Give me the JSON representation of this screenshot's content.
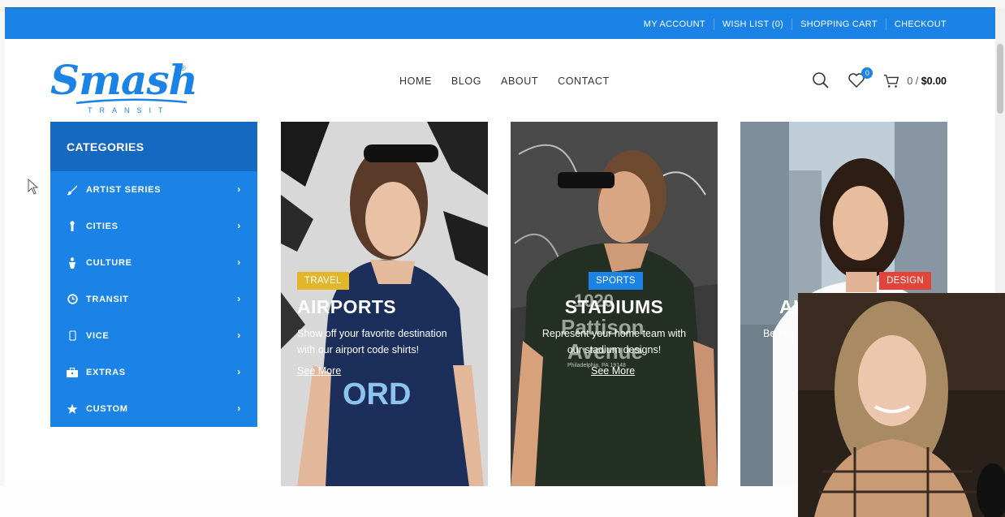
{
  "topbar": {
    "links": [
      "MY ACCOUNT",
      "WISH LIST (0)",
      "SHOPPING CART",
      "CHECKOUT"
    ]
  },
  "logo": {
    "word": "Smash",
    "sub": "TRANSIT",
    "reg": "®"
  },
  "nav": [
    "HOME",
    "BLOG",
    "ABOUT",
    "CONTACT"
  ],
  "tools": {
    "wishlist_count": "0",
    "cart_count_prefix": "0 /",
    "cart_total": "$0.00"
  },
  "categories": {
    "title": "CATEGORIES",
    "items": [
      {
        "label": "ARTIST SERIES",
        "icon": "brush-icon"
      },
      {
        "label": "CITIES",
        "icon": "pin-icon"
      },
      {
        "label": "CULTURE",
        "icon": "person-icon"
      },
      {
        "label": "TRANSIT",
        "icon": "clock-icon"
      },
      {
        "label": "VICE",
        "icon": "phone-icon"
      },
      {
        "label": "EXTRAS",
        "icon": "briefcase-icon"
      },
      {
        "label": "CUSTOM",
        "icon": "star-icon"
      }
    ]
  },
  "cards": [
    {
      "tag": "TRAVEL",
      "tag_color": "#e2b62a",
      "title": "AIRPORTS",
      "desc1": "Show off your favorite destination",
      "desc2": "with our airport code shirts!",
      "more": "See More",
      "shirt_text": "ORD"
    },
    {
      "tag": "SPORTS",
      "tag_color": "#1b82e6",
      "title": "STADIUMS",
      "desc1": "Represent your home team with",
      "desc2": "our stadium designs!",
      "more": "See More",
      "shirt_text1": "1020",
      "shirt_text2": "Pattison",
      "shirt_text3": "Avenue",
      "shirt_small": "Philadelphia, PA 19148"
    },
    {
      "tag": "DESIGN",
      "tag_color": "#e2443a",
      "title": "AI",
      "desc1": "Be insp"
    }
  ],
  "colors": {
    "brand": "#1b82e6",
    "brand_dark": "#1669c0"
  }
}
